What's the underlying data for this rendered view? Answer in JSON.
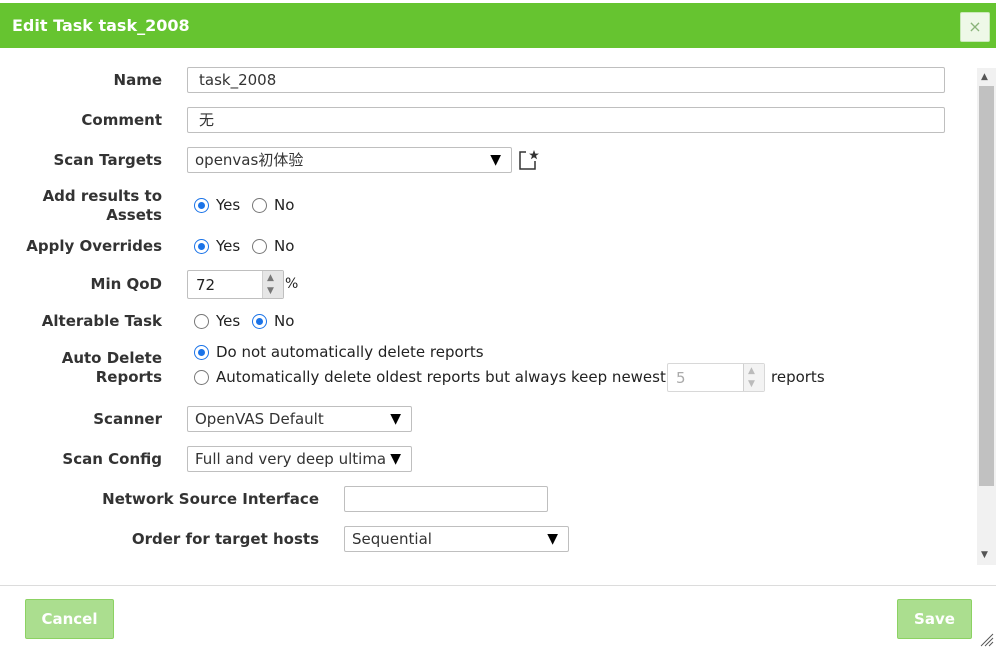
{
  "dialog": {
    "title": "Edit Task task_2008",
    "close_symbol": "×"
  },
  "form": {
    "name": {
      "label": "Name",
      "value": "task_2008"
    },
    "comment": {
      "label": "Comment",
      "value": "无"
    },
    "scan_targets": {
      "label": "Scan Targets",
      "value": "openvas初体验",
      "icon": "new-target-icon"
    },
    "add_results_to_assets": {
      "label_line1": "Add results to",
      "label_line2": "Assets",
      "options": [
        "Yes",
        "No"
      ],
      "selected": "Yes"
    },
    "apply_overrides": {
      "label": "Apply Overrides",
      "options": [
        "Yes",
        "No"
      ],
      "selected": "Yes"
    },
    "min_qod": {
      "label": "Min QoD",
      "value": "72",
      "unit": "%"
    },
    "alterable_task": {
      "label": "Alterable Task",
      "options": [
        "Yes",
        "No"
      ],
      "selected": "No"
    },
    "auto_delete_reports": {
      "label_line1": "Auto Delete",
      "label_line2": "Reports",
      "option_none": "Do not automatically delete reports",
      "option_keep": "Automatically delete oldest reports but always keep newest",
      "keep_value": "5",
      "keep_suffix": "reports",
      "selected": "none"
    },
    "scanner": {
      "label": "Scanner",
      "value": "OpenVAS Default"
    },
    "scan_config": {
      "label": "Scan Config",
      "value": "Full and very deep ultima"
    },
    "network_source_interface": {
      "label": "Network Source Interface",
      "value": ""
    },
    "order_for_target_hosts": {
      "label": "Order for target hosts",
      "value": "Sequential"
    }
  },
  "footer": {
    "cancel_label": "Cancel",
    "save_label": "Save"
  },
  "colors": {
    "header": "#66c430",
    "radio_selected": "#1a73e8"
  }
}
